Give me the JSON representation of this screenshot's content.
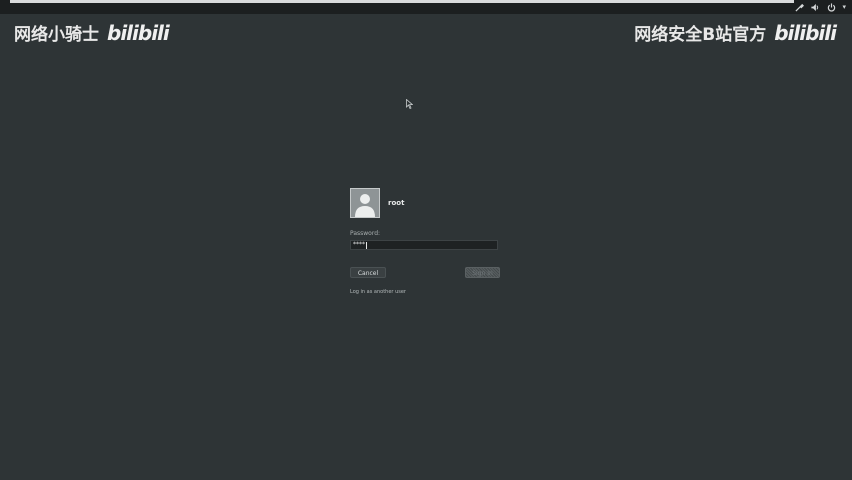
{
  "watermarks": {
    "left_text": "网络小骑士",
    "left_logo": "bilibili",
    "right_text": "网络安全B站官方",
    "right_logo": "bilibili"
  },
  "system_tray": {
    "icons": [
      "tools-icon",
      "volume-icon",
      "power-icon"
    ]
  },
  "login": {
    "username": "root",
    "password_label": "Password:",
    "password_value": "****",
    "cancel_label": "Cancel",
    "sign_in_label": "Sign In",
    "other_user_link": "Log in as another user"
  },
  "colors": {
    "background": "#2e3436",
    "field_background": "#1e2223",
    "text": "#e8eaea"
  }
}
